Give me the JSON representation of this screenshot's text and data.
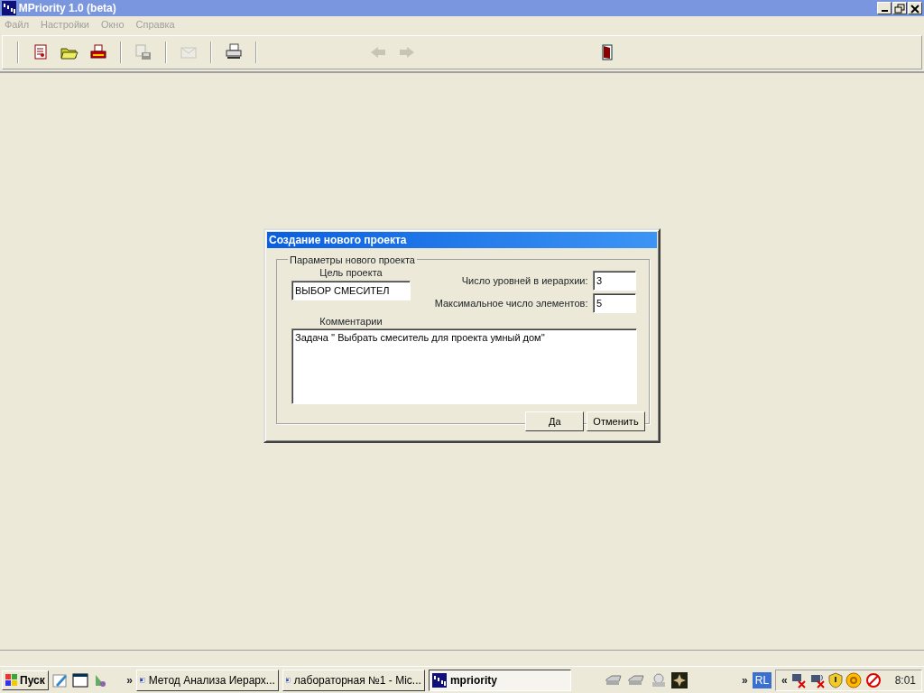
{
  "window": {
    "title": "MPriority 1.0 (beta)"
  },
  "menu": [
    "Файл",
    "Настройки",
    "Окно",
    "Справка"
  ],
  "toolbar": [
    {
      "kind": "new",
      "disabled": false
    },
    {
      "kind": "open",
      "disabled": false
    },
    {
      "kind": "print-setup",
      "disabled": false
    },
    {
      "kind": "sep"
    },
    {
      "kind": "save",
      "disabled": true
    },
    {
      "kind": "sep"
    },
    {
      "kind": "mail",
      "disabled": true
    },
    {
      "kind": "sep"
    },
    {
      "kind": "print",
      "disabled": false
    },
    {
      "kind": "sep"
    },
    {
      "kind": "back",
      "disabled": true
    },
    {
      "kind": "forward",
      "disabled": true
    },
    {
      "kind": "exit",
      "disabled": false
    }
  ],
  "dialog": {
    "title": "Создание нового проекта",
    "group_label": "Параметры нового проекта",
    "goal_label": "Цель проекта",
    "goal_value": "ВЫБОР СМЕСИТЕЛ",
    "levels_label": "Число уровней в иерархии:",
    "levels_value": "3",
    "max_label": "Максимальное число элементов:",
    "max_value": "5",
    "comments_label": "Комментарии",
    "comments_value": "Задача '' Выбрать смеситель для проекта умный дом''",
    "buttons": [
      "Да",
      "Отменить"
    ]
  },
  "taskbar": {
    "start": "Пуск",
    "more_left": "»",
    "tasks": [
      {
        "label": "Метод Анализа Иерарх...",
        "kind": "word",
        "selected": false
      },
      {
        "label": "лабораторная №1 - Mic...",
        "kind": "word",
        "selected": false
      },
      {
        "label": "mpriority",
        "kind": "app",
        "selected": true
      }
    ],
    "more_right": "»",
    "language": "RL",
    "tray_toggle": "«",
    "clock": "8:01"
  }
}
